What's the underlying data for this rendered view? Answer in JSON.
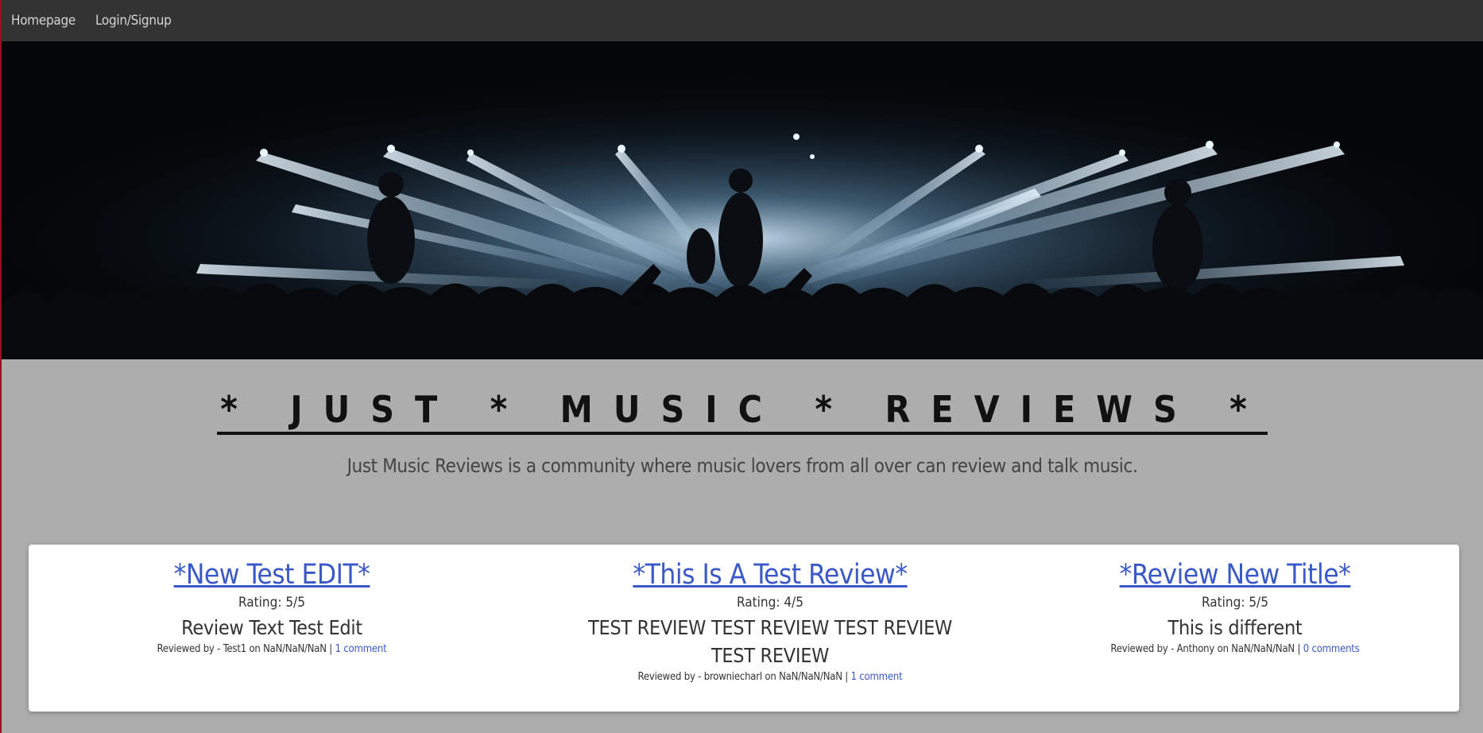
{
  "nav": {
    "items": [
      {
        "label": "Homepage"
      },
      {
        "label": "Login/Signup"
      }
    ]
  },
  "hero": {
    "image": "concert-stage-lights-photo"
  },
  "site": {
    "title": "* JUST * MUSIC * REVIEWS *",
    "tagline": "Just Music Reviews is a community where music lovers from all over can review and talk music."
  },
  "reviews": [
    {
      "title": "*New Test EDIT*",
      "rating": "Rating: 5/5",
      "text": "Review Text Test Edit",
      "meta_prefix": "Reviewed by - Test1 on NaN/NaN/NaN | ",
      "comments": "1 comment"
    },
    {
      "title": "*This Is A Test Review*",
      "rating": "Rating: 4/5",
      "text": "TEST REVIEW TEST REVIEW TEST REVIEW TEST REVIEW",
      "meta_prefix": "Reviewed by - browniecharl on NaN/NaN/NaN | ",
      "comments": "1 comment"
    },
    {
      "title": "*Review New Title*",
      "rating": "Rating: 5/5",
      "text": "This is different",
      "meta_prefix": "Reviewed by - Anthony on NaN/NaN/NaN | ",
      "comments": "0 comments"
    }
  ],
  "colors": {
    "navbar": "#333333",
    "page_bg": "#adadad",
    "link": "#3a58c8"
  }
}
